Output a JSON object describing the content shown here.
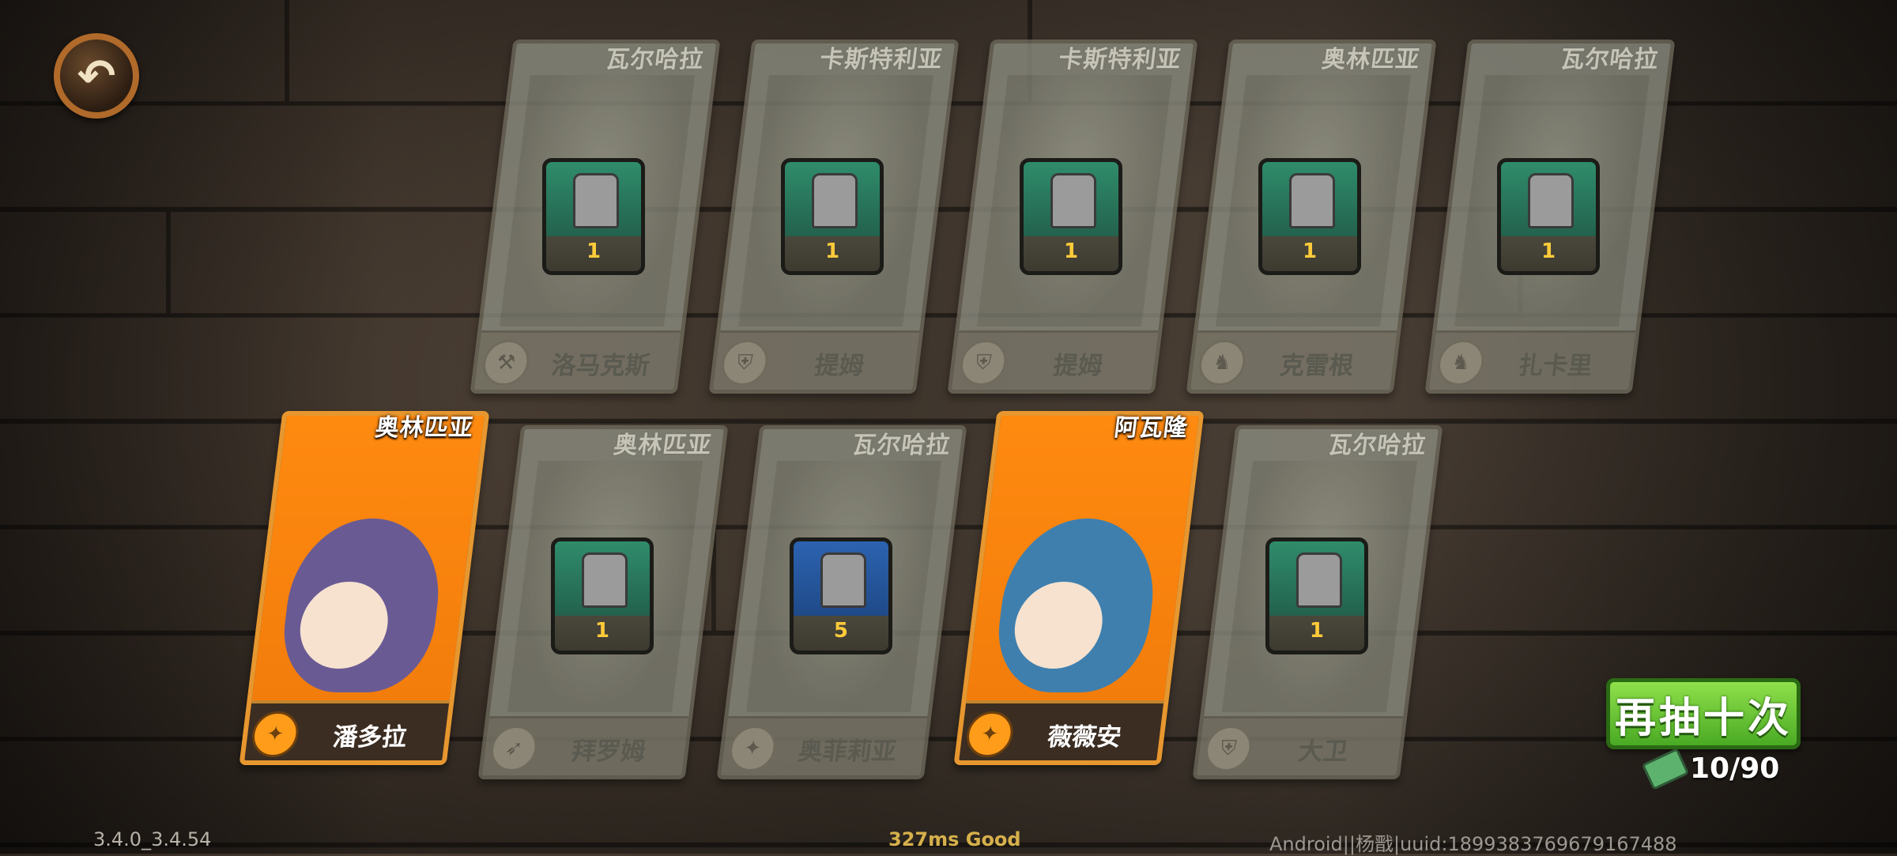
{
  "colors": {
    "gold_card": "#f07a0a",
    "grey_card": "#8d8e82",
    "draw_button": "#4aaa24",
    "item_count": "#ffcb3a"
  },
  "back_button": {
    "icon": "back-arrow-icon",
    "glyph": "↶"
  },
  "cards": [
    {
      "faction": "瓦尔哈拉",
      "name": "洛马克斯",
      "count": "1",
      "rarity": "common",
      "class_icon": "axe-class-icon",
      "tile": "green"
    },
    {
      "faction": "卡斯特利亚",
      "name": "提姆",
      "count": "1",
      "rarity": "common",
      "class_icon": "shield-class-icon",
      "tile": "green"
    },
    {
      "faction": "卡斯特利亚",
      "name": "提姆",
      "count": "1",
      "rarity": "common",
      "class_icon": "shield-class-icon",
      "tile": "green"
    },
    {
      "faction": "奥林匹亚",
      "name": "克雷根",
      "count": "1",
      "rarity": "common",
      "class_icon": "knight-class-icon",
      "tile": "green"
    },
    {
      "faction": "瓦尔哈拉",
      "name": "扎卡里",
      "count": "1",
      "rarity": "common",
      "class_icon": "knight-class-icon",
      "tile": "green"
    },
    {
      "faction": "奥林匹亚",
      "name": "潘多拉",
      "count": "",
      "rarity": "hero",
      "class_icon": "magic-class-icon",
      "tile": ""
    },
    {
      "faction": "奥林匹亚",
      "name": "拜罗姆",
      "count": "1",
      "rarity": "common",
      "class_icon": "bow-class-icon",
      "tile": "green"
    },
    {
      "faction": "瓦尔哈拉",
      "name": "奥菲莉亚",
      "count": "5",
      "rarity": "common",
      "class_icon": "magic-class-icon",
      "tile": "blue"
    },
    {
      "faction": "阿瓦隆",
      "name": "薇薇安",
      "count": "",
      "rarity": "hero",
      "class_icon": "magic-class-icon",
      "tile": ""
    },
    {
      "faction": "瓦尔哈拉",
      "name": "大卫",
      "count": "1",
      "rarity": "common",
      "class_icon": "shield-class-icon",
      "tile": "green"
    }
  ],
  "draw_again": {
    "label": "再抽十次"
  },
  "tickets": {
    "count": "10/90",
    "icon": "ticket-scroll-icon"
  },
  "footer": {
    "version": "3.4.0_3.4.54",
    "latency": "327ms Good",
    "device": "Android||杨戬|uuid:1899383769679167488"
  }
}
